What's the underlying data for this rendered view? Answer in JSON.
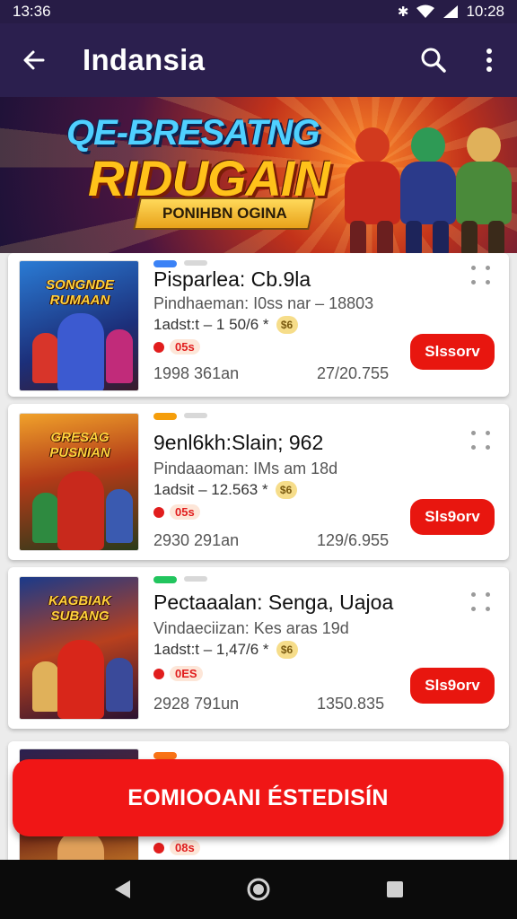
{
  "status_bar": {
    "time": "13:36",
    "clock_right": "10:28",
    "icons": [
      "bluetooth-icon",
      "wifi-icon",
      "signal-icon"
    ]
  },
  "app_bar": {
    "title": "Indansia",
    "icons": [
      "back-arrow-icon",
      "search-icon",
      "more-vert-icon"
    ]
  },
  "banner": {
    "line1": "QE-BRESATNG",
    "line2": "RIDUGAIN",
    "ribbon": "PONIHBN OGINA"
  },
  "cards": [
    {
      "thumb_title": "SONGNDE RUMAAN",
      "title": "Pisparlea: Cb.9la",
      "subtitle": "Pindhaeman: I0ss nar – 18803",
      "meta": "1adst:t – 1 50/6 *",
      "coin": "$6",
      "badge": "05s",
      "left_value": "1998 361an",
      "right_value": "27/20.755",
      "button": "Slssorv",
      "tag_color": "#3b82f6"
    },
    {
      "thumb_title": "GRESAG PUSNIAN",
      "title": "9enl6kh:Slain; 962",
      "subtitle": "Pindaaoman: IMs am 18d",
      "meta": "1adsit – 12.563 *",
      "coin": "$6",
      "badge": "05s",
      "left_value": "2930 291an",
      "right_value": "129/6.955",
      "button": "Sls9orv",
      "tag_color": "#f59e0b"
    },
    {
      "thumb_title": "KAGBIAK SUBANG",
      "title": "Pectaaalan: Senga, Uajoa",
      "subtitle": "Vindaeciizan: Kes aras 19d",
      "meta": "1adst:t – 1,47/6 *",
      "coin": "$6",
      "badge": "0ES",
      "left_value": "2928 791un",
      "right_value": "1350.835",
      "button": "Sls9orv",
      "tag_color": "#22c55e"
    },
    {
      "thumb_title": "",
      "title": "",
      "subtitle": "",
      "meta": "",
      "coin": "",
      "badge": "08s",
      "left_value": "",
      "right_value": "",
      "button": "",
      "tag_color": "#f97316"
    }
  ],
  "cta": {
    "label": "EOMIOOANI ÉSTEDISÍN"
  },
  "nav_bar": {
    "icons": [
      "back-triangle-icon",
      "home-circle-icon",
      "recents-square-icon"
    ]
  },
  "colors": {
    "app_bar": "#2b1f4e",
    "accent_red": "#e8160f",
    "cta_red": "#f01616"
  }
}
